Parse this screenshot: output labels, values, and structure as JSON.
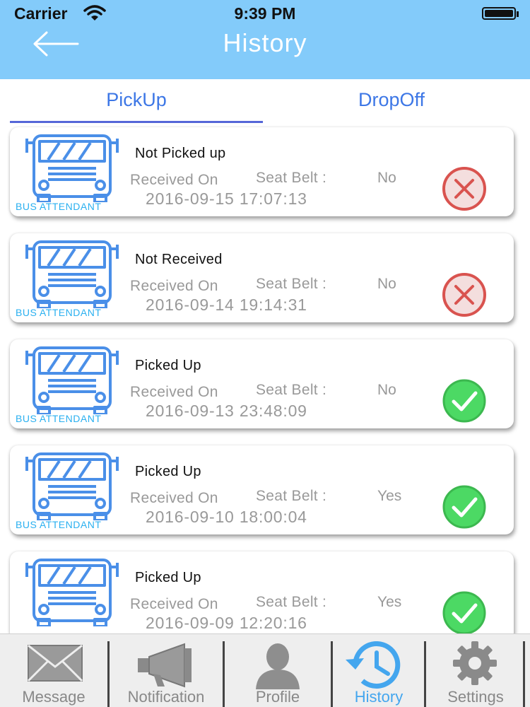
{
  "status_bar": {
    "carrier": "Carrier",
    "time": "9:39 PM"
  },
  "header": {
    "title": "History",
    "back_icon": "arrow-left-icon"
  },
  "tabs": [
    {
      "label": "PickUp",
      "selected": true
    },
    {
      "label": "DropOff",
      "selected": false
    }
  ],
  "colors": {
    "header": "#83cbfa",
    "accent": "#3d77e6",
    "bus": "#4a8fe8",
    "error": "#d9534f",
    "success": "#4cd964"
  },
  "records": [
    {
      "bus_label": "BUS ATTENDANT",
      "status": "Not Picked up",
      "received_label": "Received On",
      "seat_label": "Seat Belt :",
      "seat_value": "No",
      "date": "2016-09-15 17:07:13",
      "result_icon": "cross-icon"
    },
    {
      "bus_label": "BUS ATTENDANT",
      "status": "Not Received",
      "received_label": "Received On",
      "seat_label": "Seat Belt :",
      "seat_value": "No",
      "date": "2016-09-14 19:14:31",
      "result_icon": "cross-icon"
    },
    {
      "bus_label": "BUS ATTENDANT",
      "status": "Picked Up",
      "received_label": "Received On",
      "seat_label": "Seat Belt :",
      "seat_value": "No",
      "date": "2016-09-13 23:48:09",
      "result_icon": "check-icon"
    },
    {
      "bus_label": "BUS ATTENDANT",
      "status": "Picked Up",
      "received_label": "Received On",
      "seat_label": "Seat Belt :",
      "seat_value": "Yes",
      "date": "2016-09-10 18:00:04",
      "result_icon": "check-icon"
    },
    {
      "bus_label": "",
      "status": "Picked Up",
      "received_label": "Received On",
      "seat_label": "Seat Belt :",
      "seat_value": "Yes",
      "date": "2016-09-09 12:20:16",
      "result_icon": "check-icon"
    }
  ],
  "bottom_nav": [
    {
      "label": "Message",
      "icon": "envelope-icon",
      "active": false
    },
    {
      "label": "Notification",
      "icon": "megaphone-icon",
      "active": false
    },
    {
      "label": "Profile",
      "icon": "person-icon",
      "active": false
    },
    {
      "label": "History",
      "icon": "history-clock-icon",
      "active": true
    },
    {
      "label": "Settings",
      "icon": "gear-icon",
      "active": false
    }
  ]
}
